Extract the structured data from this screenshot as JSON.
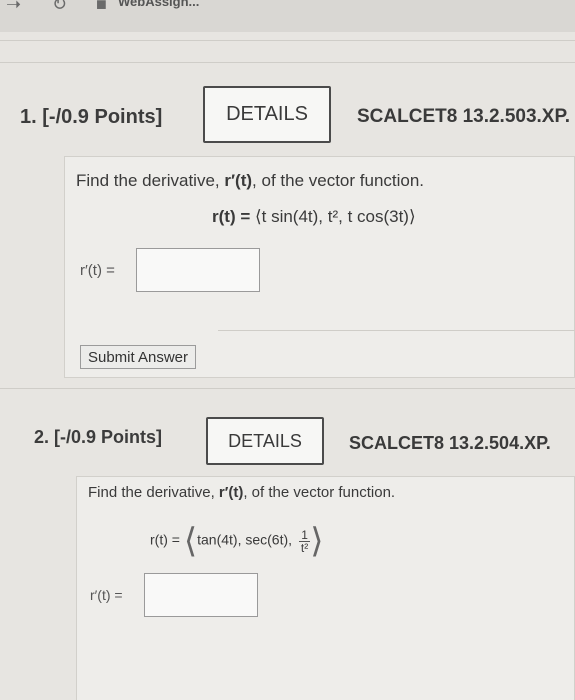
{
  "browser": {
    "tab_title": "WebAssign..."
  },
  "questions": [
    {
      "number": "1.",
      "points": "[-/0.9 Points]",
      "details_label": "DETAILS",
      "code": "SCALCET8 13.2.503.XP.",
      "prompt_pre": "Find the derivative, ",
      "prompt_sym": "r′(t)",
      "prompt_post": ", of the vector function.",
      "fn_lhs": "r(t) = ",
      "fn_body": "⟨t sin(4t), t², t cos(3t)⟩",
      "answer_label": "r′(t) =",
      "answer_value": "",
      "submit_label": "Submit Answer"
    },
    {
      "number": "2.",
      "points": "[-/0.9 Points]",
      "details_label": "DETAILS",
      "code": "SCALCET8 13.2.504.XP.",
      "prompt_pre": "Find the derivative, ",
      "prompt_sym": "r′(t)",
      "prompt_post": ", of the vector function.",
      "fn_lhs": "r(t) = ",
      "fn_open": "⟨",
      "fn_body": "tan(4t), sec(6t), ",
      "frac_num": "1",
      "frac_den": "t²",
      "fn_close": "⟩",
      "answer_label": "r′(t) =",
      "answer_value": ""
    }
  ]
}
